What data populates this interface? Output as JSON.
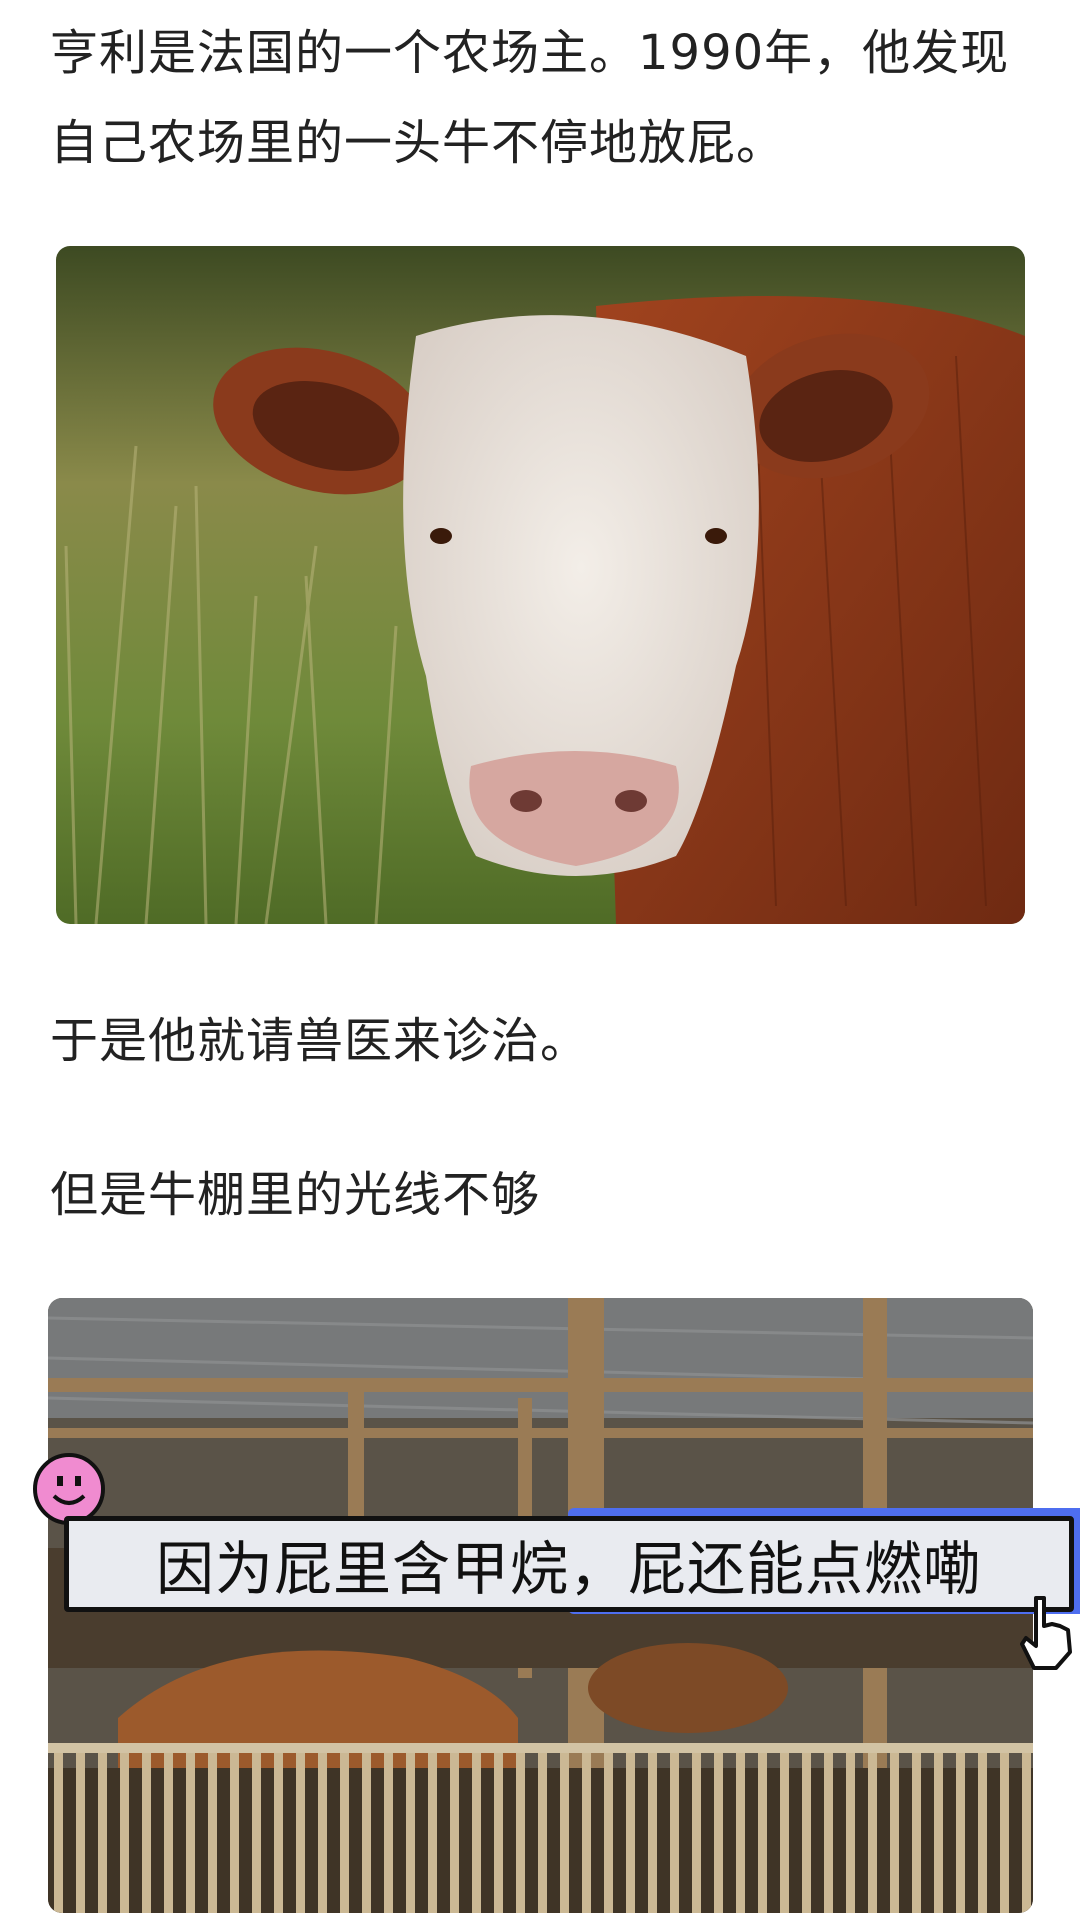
{
  "article": {
    "paragraph_1": "亨利是法国的一个农场主。1990年，他发现自己农场里的一头牛不停地放屁。",
    "paragraph_2": "于是他就请兽医来诊治。",
    "paragraph_3": "但是牛棚里的光线不够"
  },
  "images": {
    "cow_photo": "cow-portrait-photo",
    "barn_photo": "cow-barn-photo"
  },
  "overlay": {
    "caption": "因为屁里含甲烷，屁还能点燃嘞",
    "sticker_icon": "smiley-face-icon",
    "cursor_icon": "hand-pointer-icon"
  },
  "colors": {
    "caption_accent": "#4e6ef0",
    "caption_bg": "#e9ebf0",
    "sticker": "#f08bd0"
  }
}
